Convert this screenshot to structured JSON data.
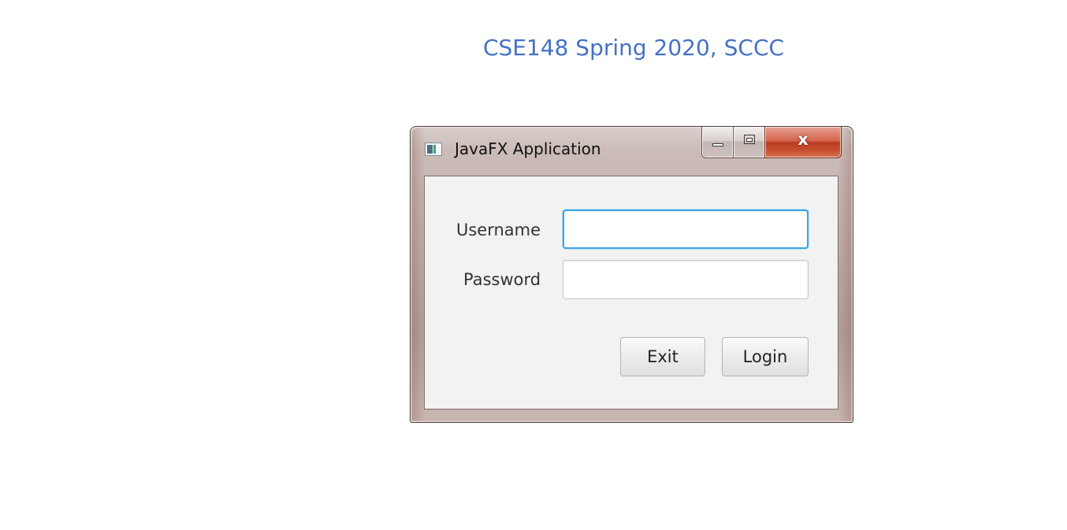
{
  "heading": {
    "text": "CSE148 Spring 2020, SCCC",
    "color": "#4472c4"
  },
  "window": {
    "title": "JavaFX Application",
    "icon": "javafx-app-icon",
    "caption_buttons": {
      "minimize_icon": "minimize-icon",
      "maximize_icon": "maximize-icon",
      "close_label": "x"
    }
  },
  "form": {
    "username_label": "Username",
    "password_label": "Password",
    "username_value": "",
    "password_value": "",
    "focus_color": "#3ba5dd"
  },
  "buttons": {
    "exit_label": "Exit",
    "login_label": "Login"
  }
}
